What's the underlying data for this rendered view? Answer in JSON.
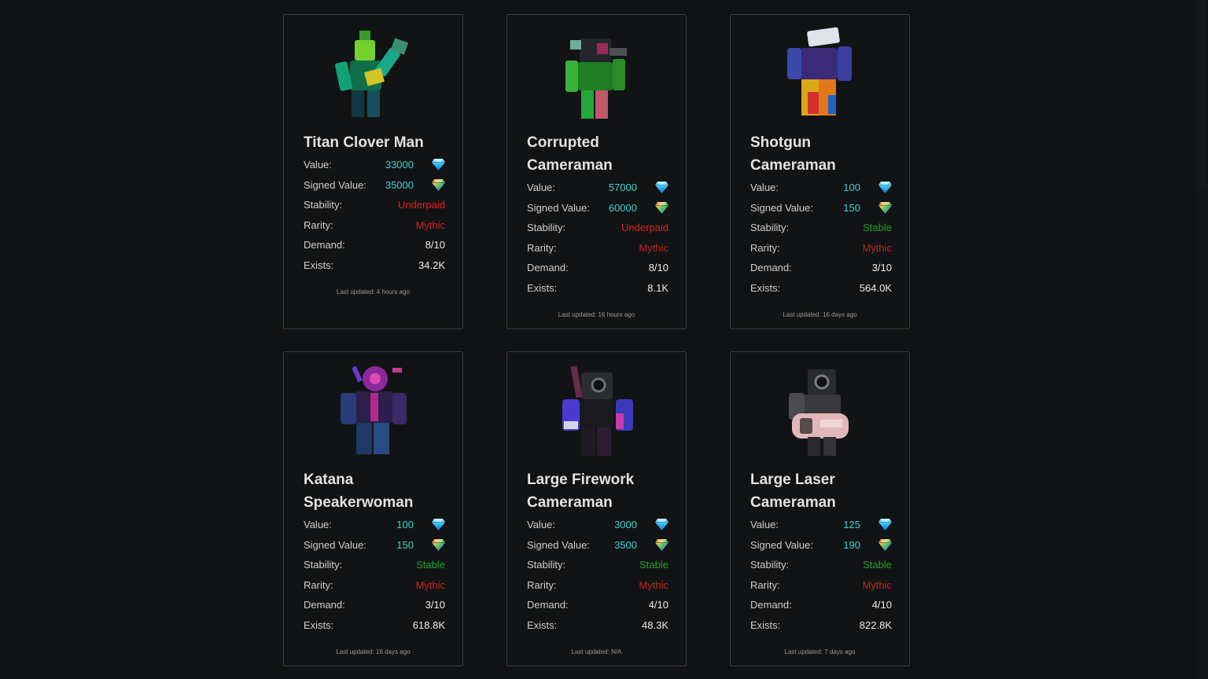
{
  "labels": {
    "value": "Value:",
    "signed_value": "Signed Value:",
    "stability": "Stability:",
    "rarity": "Rarity:",
    "demand": "Demand:",
    "exists": "Exists:"
  },
  "icons": {
    "value_gem": "blue-diamond-icon",
    "signed_gem": "rainbow-diamond-icon"
  },
  "colors": {
    "background": "#111213",
    "card_border": "#3a3c40",
    "gem_value": "#3ed2d2",
    "underpaid": "#e02222",
    "mythic": "#c42424",
    "stable": "#23a12f"
  },
  "cards": [
    {
      "name": "Titan Clover Man",
      "value": "33000",
      "signed_value": "35000",
      "stability": "Underpaid",
      "rarity": "Mythic",
      "demand": "8/10",
      "exists": "34.2K",
      "updated": "Last updated: 4 hours ago"
    },
    {
      "name": "Corrupted Cameraman",
      "value": "57000",
      "signed_value": "60000",
      "stability": "Underpaid",
      "rarity": "Mythic",
      "demand": "8/10",
      "exists": "8.1K",
      "updated": "Last updated: 16 hours ago"
    },
    {
      "name": "Shotgun Cameraman",
      "value": "100",
      "signed_value": "150",
      "stability": "Stable",
      "rarity": "Mythic",
      "demand": "3/10",
      "exists": "564.0K",
      "updated": "Last updated: 16 days ago"
    },
    {
      "name": "Katana Speakerwoman",
      "value": "100",
      "signed_value": "150",
      "stability": "Stable",
      "rarity": "Mythic",
      "demand": "3/10",
      "exists": "618.8K",
      "updated": "Last updated: 16 days ago"
    },
    {
      "name": "Large Firework Cameraman",
      "value": "3000",
      "signed_value": "3500",
      "stability": "Stable",
      "rarity": "Mythic",
      "demand": "4/10",
      "exists": "48.3K",
      "updated": "Last updated: N/A"
    },
    {
      "name": "Large Laser Cameraman",
      "value": "125",
      "signed_value": "190",
      "stability": "Stable",
      "rarity": "Mythic",
      "demand": "4/10",
      "exists": "822.8K",
      "updated": "Last updated: 7 days ago"
    }
  ]
}
